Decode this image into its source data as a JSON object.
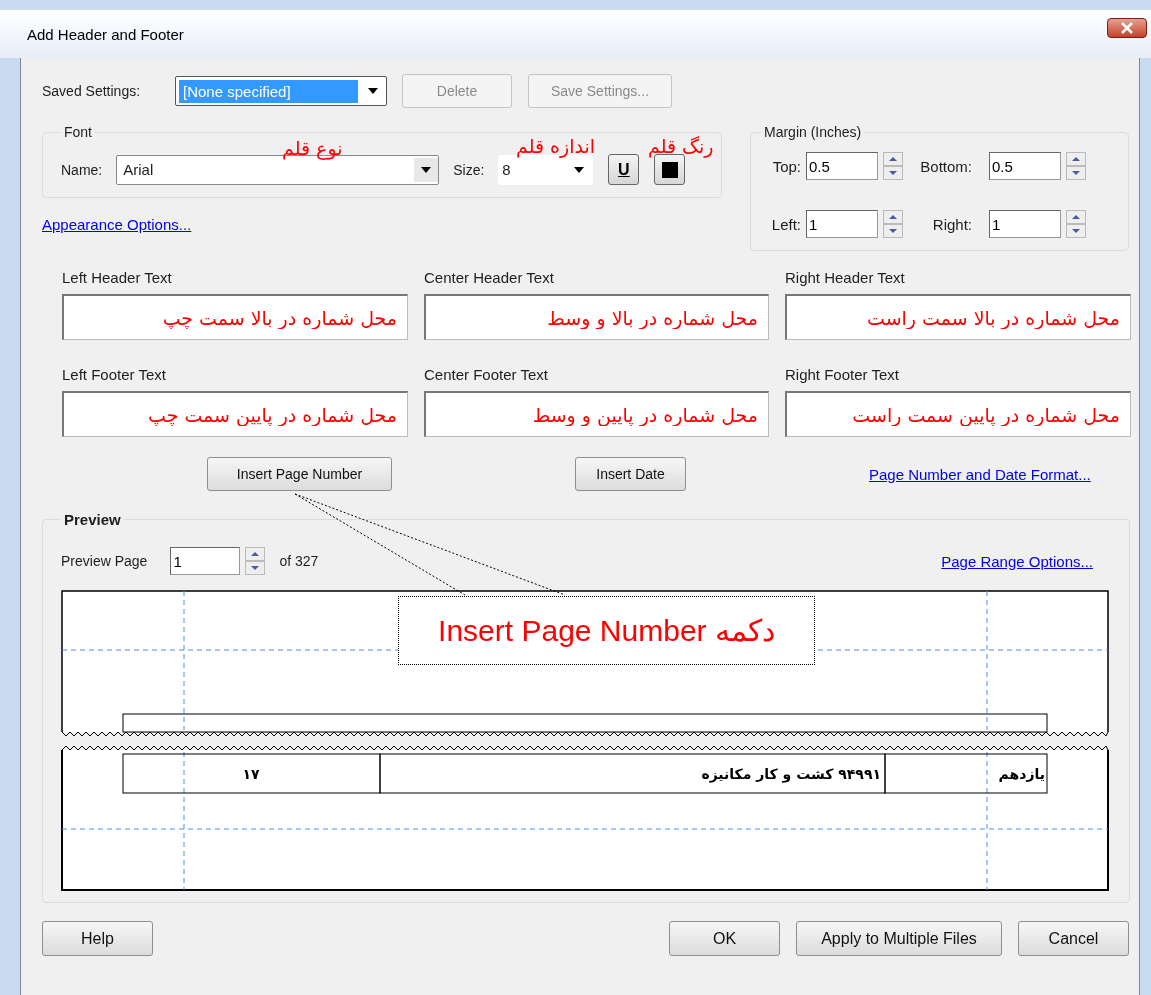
{
  "window": {
    "title": "Add Header and Footer"
  },
  "saved_settings": {
    "label": "Saved Settings:",
    "value": "[None specified]",
    "buttons": [
      {
        "label": "Delete",
        "disabled": true
      },
      {
        "label": "Save Settings...",
        "disabled": true
      }
    ]
  },
  "font": {
    "title": "Font",
    "name_label": "Name:",
    "name": "Arial",
    "size_label": "Size:",
    "size": "8",
    "underline_label": "U"
  },
  "appearance_link": "Appearance Options...",
  "margin": {
    "title": "Margin (Inches)",
    "fields": [
      {
        "label": "Top:",
        "value": "0.5"
      },
      {
        "label": "Bottom:",
        "value": "0.5"
      },
      {
        "label": "Left:",
        "value": "1"
      },
      {
        "label": "Right:",
        "value": "1"
      }
    ]
  },
  "header_fields": {
    "left": {
      "label": "Left Header Text",
      "value": "محل شماره در بالا سمت چپ"
    },
    "center": {
      "label": "Center Header Text",
      "value": "محل شماره در بالا و وسط"
    },
    "right": {
      "label": "Right Header Text",
      "value": "محل شماره در بالا سمت راست"
    }
  },
  "footer_fields": {
    "left": {
      "label": "Left Footer Text",
      "value": "محل شماره در پایین سمت چپ"
    },
    "center": {
      "label": "Center Footer Text",
      "value": "محل شماره در پایین و وسط"
    },
    "right": {
      "label": "Right Footer Text",
      "value": "محل شماره در پایین سمت راست"
    }
  },
  "insert_buttons": [
    "Insert Page Number",
    "Insert Date"
  ],
  "format_link": "Page Number and Date Format...",
  "preview": {
    "title": "Preview",
    "page_label": "Preview Page",
    "page": "1",
    "page_count": "of 327",
    "range_link": "Page Range Options...",
    "table_row": {
      "column_1": "۱۷",
      "column_2": "۹۴۹۹۱ کشت و کار مکانیزه",
      "column_3": "یازدهم"
    }
  },
  "annotations": {
    "font_name_note": "نوع قلم",
    "font_size_note": "اندازه قلم",
    "font_color_note": "رنگ قلم"
  },
  "callout": {
    "text": "دکمه Insert Page Number"
  },
  "footer_buttons": [
    "Help",
    "OK",
    "Apply to Multiple Files",
    "Cancel"
  ]
}
